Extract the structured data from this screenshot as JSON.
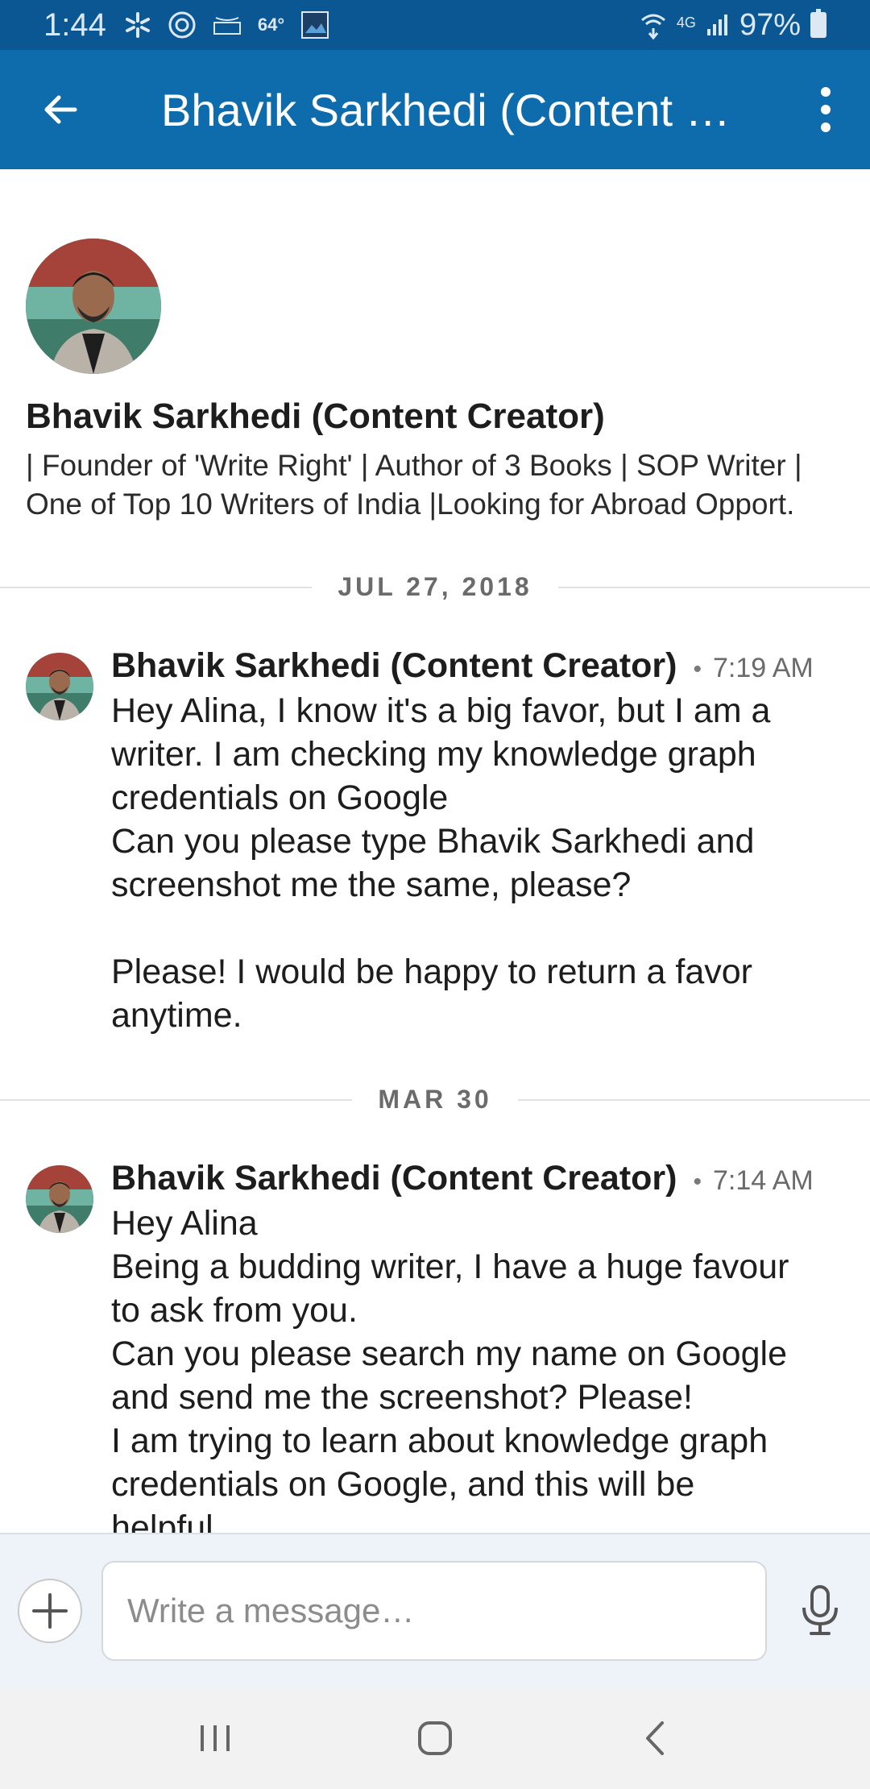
{
  "status_bar": {
    "time": "1:44",
    "temperature": "64°",
    "battery": "97%",
    "network": "4G",
    "icons": [
      "walmart-spark-icon",
      "app-icon",
      "amazon-icon",
      "weather-icon",
      "image-icon",
      "wifi-calling-icon",
      "signal-icon",
      "battery-icon"
    ]
  },
  "app_bar": {
    "title": "Bhavik Sarkhedi (Content C…",
    "back_icon": "arrow-left-icon",
    "more_icon": "more-vertical-icon"
  },
  "profile": {
    "name": "Bhavik Sarkhedi (Content Creator)",
    "headline": "| Founder of 'Write Right' | Author of 3 Books | SOP Writer |\nOne of Top 10 Writers of India |Looking for Abroad Opport."
  },
  "conversation": {
    "dates": [
      "JUL 27, 2018",
      "MAR 30"
    ],
    "messages": [
      {
        "sender": "Bhavik Sarkhedi (Content Creator)",
        "time": "7:19 AM",
        "text": "Hey Alina, I know it's a big favor, but I am a\nwriter. I am checking my knowledge graph\ncredentials on Google\nCan you please type Bhavik Sarkhedi and\nscreenshot me the same, please?\n\nPlease! I would be happy to return a favor\nanytime."
      },
      {
        "sender": "Bhavik Sarkhedi (Content Creator)",
        "time": "7:14 AM",
        "text": "Hey Alina\nBeing a budding writer, I have a huge favour\nto ask from you.\nCan you please search my name on Google\nand send me the screenshot? Please!\nI am trying to learn about knowledge graph\ncredentials on Google, and this will be\nhelpful"
      }
    ]
  },
  "compose": {
    "placeholder": "Write a message…",
    "plus_icon": "plus-icon",
    "mic_icon": "microphone-icon"
  },
  "nav_bar": {
    "icons": [
      "recent-apps-icon",
      "home-icon",
      "back-icon"
    ]
  },
  "colors": {
    "status_bar": "#0b5794",
    "app_bar": "#0e6cad",
    "compose_bg": "#edf3f8",
    "nav_bg": "#f2f2f2"
  }
}
